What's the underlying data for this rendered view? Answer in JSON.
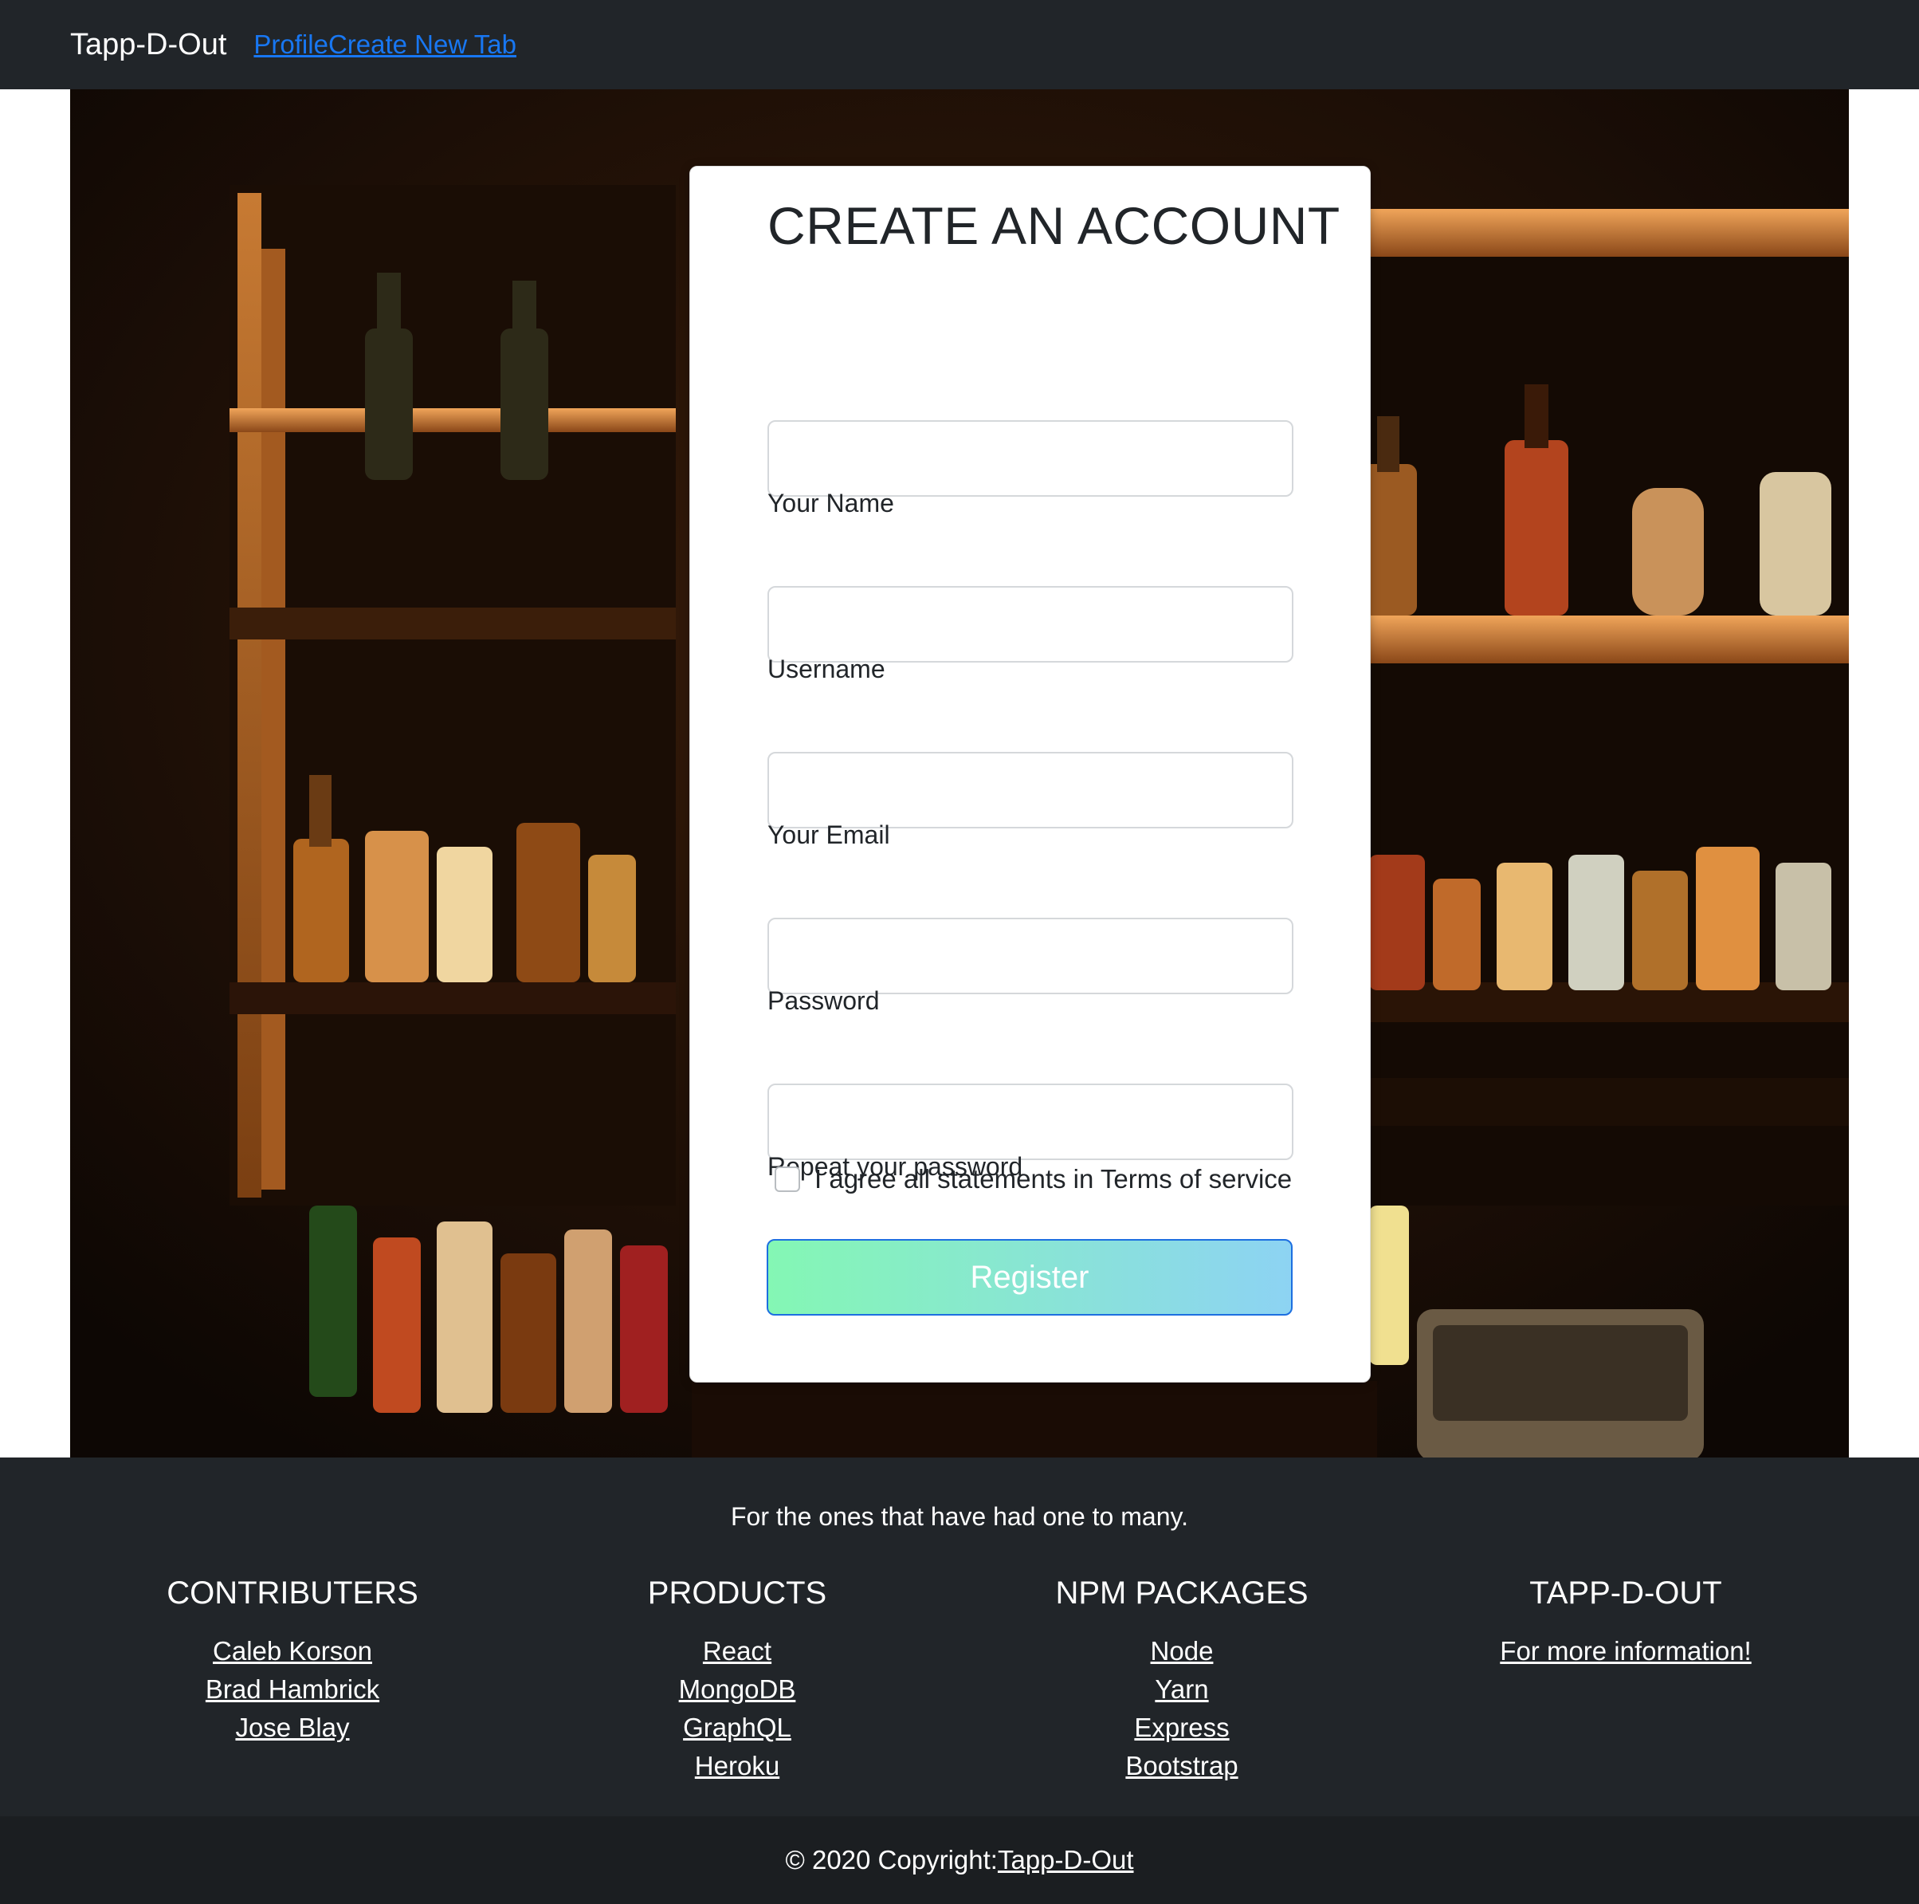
{
  "navbar": {
    "brand": "Tapp-D-Out",
    "links": [
      "Profile",
      "Create New Tab"
    ]
  },
  "hero": {
    "background": "bar-shelves-photo"
  },
  "form": {
    "title": "CREATE AN ACCOUNT",
    "fields": [
      {
        "label": "Your Name",
        "value": "",
        "placeholder": ""
      },
      {
        "label": "Username",
        "value": "",
        "placeholder": ""
      },
      {
        "label": "Your Email",
        "value": "",
        "placeholder": ""
      },
      {
        "label": "Password",
        "value": "",
        "placeholder": ""
      },
      {
        "label": "Repeat your password",
        "value": "",
        "placeholder": ""
      }
    ],
    "terms_label": "I agree all statements in Terms of service",
    "terms_checked": false,
    "register_label": "Register"
  },
  "footer": {
    "tagline": "For the ones that have had one to many.",
    "columns": [
      {
        "heading": "CONTRIBUTERS",
        "links": [
          "Caleb Korson",
          "Brad Hambrick",
          "Jose Blay"
        ]
      },
      {
        "heading": "PRODUCTS",
        "links": [
          "React",
          "MongoDB",
          "GraphQL",
          "Heroku"
        ]
      },
      {
        "heading": "NPM PACKAGES",
        "links": [
          "Node",
          "Yarn",
          "Express",
          "Bootstrap"
        ]
      },
      {
        "heading": "TAPP-D-OUT",
        "links": [
          "For more information!"
        ]
      }
    ],
    "copyright_prefix": "© 2020 Copyright:",
    "copyright_link": "Tapp-D-Out"
  },
  "colors": {
    "navbar_bg": "#212529",
    "link_blue": "#1877f2",
    "button_gradient_start": "#84f7b4",
    "button_gradient_end": "#8dd3f3",
    "button_border": "#1d6fe0"
  }
}
